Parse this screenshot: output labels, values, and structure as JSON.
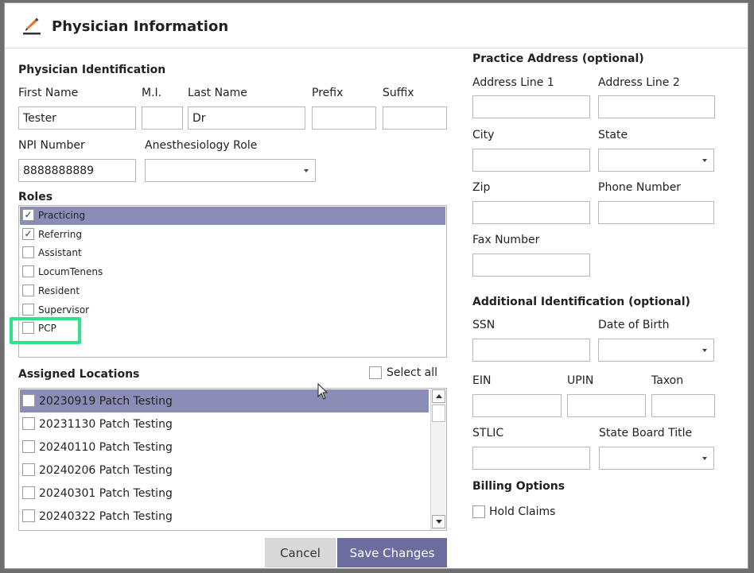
{
  "dialog": {
    "title": "Physician Information",
    "icon": "pencil-icon"
  },
  "physician_identification": {
    "heading": "Physician Identification",
    "first_name": {
      "label": "First Name",
      "value": "Tester"
    },
    "mi": {
      "label": "M.I.",
      "value": ""
    },
    "last_name": {
      "label": "Last Name",
      "value": "Dr"
    },
    "prefix": {
      "label": "Prefix",
      "value": ""
    },
    "suffix": {
      "label": "Suffix",
      "value": ""
    },
    "npi": {
      "label": "NPI Number",
      "value": "8888888889"
    },
    "anesthesiology_role": {
      "label": "Anesthesiology Role",
      "value": ""
    }
  },
  "roles": {
    "heading": "Roles",
    "items": [
      {
        "label": "Practicing",
        "checked": true,
        "selected": true
      },
      {
        "label": "Referring",
        "checked": true,
        "selected": false
      },
      {
        "label": "Assistant",
        "checked": false,
        "selected": false
      },
      {
        "label": "LocumTenens",
        "checked": false,
        "selected": false
      },
      {
        "label": "Resident",
        "checked": false,
        "selected": false
      },
      {
        "label": "Supervisor",
        "checked": false,
        "selected": false
      },
      {
        "label": "PCP",
        "checked": false,
        "selected": false,
        "highlighted": true
      }
    ],
    "highlight_color": "#2de38a",
    "selection_color": "#8b8db6"
  },
  "assigned_locations": {
    "heading": "Assigned Locations",
    "select_all_label": "Select all",
    "items": [
      {
        "label": "20230919 Patch Testing",
        "checked": false,
        "selected": true
      },
      {
        "label": "20231130 Patch Testing",
        "checked": false,
        "selected": false
      },
      {
        "label": "20240110 Patch Testing",
        "checked": false,
        "selected": false
      },
      {
        "label": "20240206 Patch Testing",
        "checked": false,
        "selected": false
      },
      {
        "label": "20240301 Patch Testing",
        "checked": false,
        "selected": false
      },
      {
        "label": "20240322 Patch Testing",
        "checked": false,
        "selected": false
      }
    ]
  },
  "practice_address": {
    "heading": "Practice Address (optional)",
    "address1": {
      "label": "Address Line 1",
      "value": ""
    },
    "address2": {
      "label": "Address Line 2",
      "value": ""
    },
    "city": {
      "label": "City",
      "value": ""
    },
    "state": {
      "label": "State",
      "value": ""
    },
    "zip": {
      "label": "Zip",
      "value": ""
    },
    "phone": {
      "label": "Phone Number",
      "value": ""
    },
    "fax": {
      "label": "Fax Number",
      "value": ""
    }
  },
  "additional_identification": {
    "heading": "Additional Identification (optional)",
    "ssn": {
      "label": "SSN",
      "value": ""
    },
    "dob": {
      "label": "Date of Birth",
      "value": ""
    },
    "ein": {
      "label": "EIN",
      "value": ""
    },
    "upin": {
      "label": "UPIN",
      "value": ""
    },
    "taxon": {
      "label": "Taxon",
      "value": ""
    },
    "stlic": {
      "label": "STLIC",
      "value": ""
    },
    "state_board_title": {
      "label": "State Board Title",
      "value": ""
    }
  },
  "billing_options": {
    "heading": "Billing Options",
    "hold_claims": {
      "label": "Hold Claims",
      "checked": false
    }
  },
  "buttons": {
    "cancel": "Cancel",
    "save": "Save Changes"
  },
  "colors": {
    "save_button": "#6c6c9e",
    "cancel_button": "#d9d9d9"
  }
}
